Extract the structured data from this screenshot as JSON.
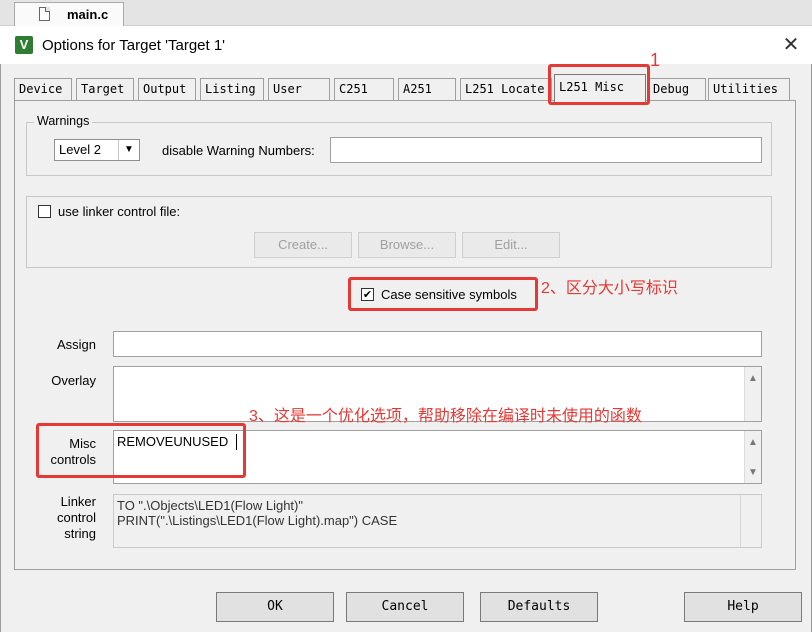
{
  "editor_tab": {
    "filename": "main.c"
  },
  "dialog": {
    "title": "Options for Target 'Target 1'",
    "close_glyph": "✕"
  },
  "tabs": [
    {
      "label": "Device"
    },
    {
      "label": "Target"
    },
    {
      "label": "Output"
    },
    {
      "label": "Listing"
    },
    {
      "label": "User"
    },
    {
      "label": "C251"
    },
    {
      "label": "A251"
    },
    {
      "label": "L251 Locate"
    },
    {
      "label": "L251 Misc"
    },
    {
      "label": "Debug"
    },
    {
      "label": "Utilities"
    }
  ],
  "active_tab": "L251 Misc",
  "warnings": {
    "legend": "Warnings",
    "level_value": "Level 2",
    "disable_label": "disable Warning Numbers:",
    "disable_value": ""
  },
  "linker_file": {
    "checkbox_label": "use linker control file:",
    "checked": false,
    "create_label": "Create...",
    "browse_label": "Browse...",
    "edit_label": "Edit..."
  },
  "case_sensitive": {
    "label": "Case sensitive symbols",
    "checked": true,
    "check_glyph": "✔"
  },
  "assign": {
    "label": "Assign",
    "value": ""
  },
  "overlay": {
    "label": "Overlay",
    "value": ""
  },
  "misc_controls": {
    "label_line1": "Misc",
    "label_line2": "controls",
    "value": "REMOVEUNUSED"
  },
  "linker_string": {
    "label_line1": "Linker",
    "label_line2": "control",
    "label_line3": "string",
    "line1": "TO \".\\Objects\\LED1(Flow Light)\"",
    "line2": "PRINT(\".\\Listings\\LED1(Flow Light).map\") CASE"
  },
  "buttons": {
    "ok": "OK",
    "cancel": "Cancel",
    "defaults": "Defaults",
    "help": "Help"
  },
  "annotations": {
    "a1": "1",
    "a2": "2、区分大小写标识",
    "a3": "3、这是一个优化选项，帮助移除在编译时未使用的函数"
  },
  "colors": {
    "annotation_red": "#e53935",
    "app_icon_green": "#2f7d32"
  }
}
